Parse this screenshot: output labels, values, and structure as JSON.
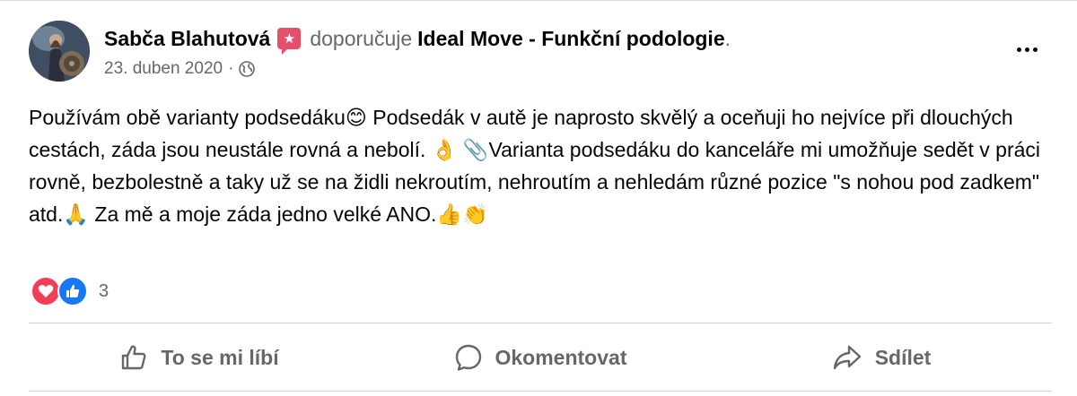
{
  "post": {
    "author": "Sabča Blahutová",
    "badge_icon": "star-badge-icon",
    "recommends_text": "doporučuje",
    "page_name": "Ideal Move - Funkční podologie",
    "page_name_period": ".",
    "date": "23. duben 2020",
    "meta_separator": "·",
    "audience_icon": "globe-icon",
    "body": "Používám obě varianty podsedáku😊 Podsedák v autě je naprosto skvělý a oceňuji ho nejvíce při dlouchých cestách, záda jsou neustále rovná a nebolí. 👌 📎Varianta podsedáku do kanceláře mi umožňuje sedět v práci rovně, bezbolestně a taky už se na židli nekroutím, nehroutím a nehledám různé pozice \"s nohou pod zadkem\" atd.🙏 Za mě a moje záda jedno velké ANO.👍👏"
  },
  "reactions": {
    "icons": [
      "love-reaction-icon",
      "like-reaction-icon"
    ],
    "count": "3"
  },
  "actions": {
    "like_label": "To se mi líbí",
    "comment_label": "Okomentovat",
    "share_label": "Sdílet"
  },
  "colors": {
    "text": "#050505",
    "secondary": "#65676b",
    "like_blue": "#1877f2",
    "love_red": "#f33e58",
    "badge_pink": "#e4506c",
    "divider": "#ced0d4"
  }
}
